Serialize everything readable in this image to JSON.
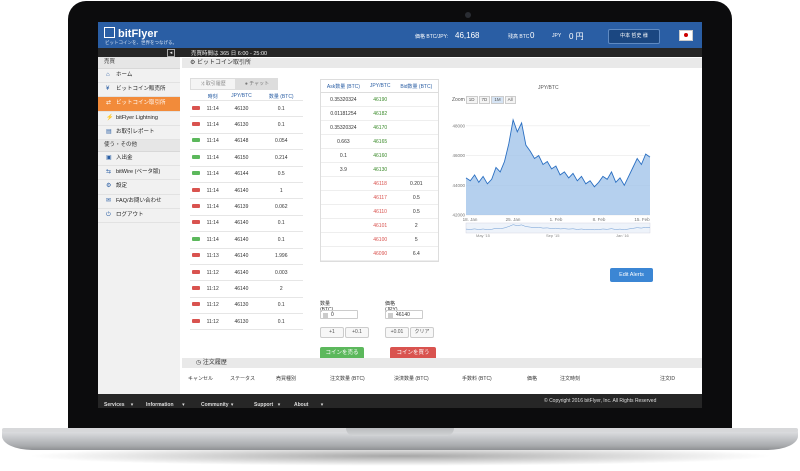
{
  "header": {
    "brand": "bitFlyer",
    "tagline": "ビットコインを、世界をつなげる。",
    "price_label": "価格 BTC/JPY:",
    "price_value": "46,168",
    "balance_btc_label": "残高 BTC",
    "balance_btc_value": "0",
    "balance_jpy_label": "JPY",
    "balance_jpy_value": "0 円",
    "user_button": "中本 哲史 様",
    "flag": "japan-flag-icon"
  },
  "timebar": {
    "hours": "売買時間は 365 日 6:00 - 25:00"
  },
  "sidebar": {
    "section1": "売買",
    "items": [
      {
        "label": "ホーム",
        "icon": "home-icon"
      },
      {
        "label": "ビットコイン販売所",
        "icon": "yen-icon"
      },
      {
        "label": "ビットコイン取引所",
        "icon": "exchange-icon"
      },
      {
        "label": "bitFlyer Lightning",
        "icon": "lightning-icon"
      },
      {
        "label": "お取引レポート",
        "icon": "report-icon"
      }
    ],
    "section2": "使う・その他",
    "items2": [
      {
        "label": "入出金",
        "icon": "wallet-icon"
      },
      {
        "label": "bitWire (ベータ版)",
        "icon": "bitwire-icon"
      },
      {
        "label": "設定",
        "icon": "gear-icon"
      },
      {
        "label": "FAQ/お問い合わせ",
        "icon": "faq-icon"
      },
      {
        "label": "ログアウト",
        "icon": "logout-icon"
      }
    ]
  },
  "page": {
    "title": "ビットコイン取引所"
  },
  "tabs": {
    "history": "取引履歴",
    "chat": "チャット"
  },
  "trades": {
    "headers": [
      "時刻",
      "JPY/BTC",
      "数量 (BTC)"
    ],
    "rows": [
      {
        "side": "sell",
        "time": "11:14",
        "price": "46130",
        "qty": "0.1"
      },
      {
        "side": "sell",
        "time": "11:14",
        "price": "46130",
        "qty": "0.1"
      },
      {
        "side": "buy",
        "time": "11:14",
        "price": "46148",
        "qty": "0.054"
      },
      {
        "side": "buy",
        "time": "11:14",
        "price": "46150",
        "qty": "0.214"
      },
      {
        "side": "buy",
        "time": "11:14",
        "price": "46144",
        "qty": "0.5"
      },
      {
        "side": "sell",
        "time": "11:14",
        "price": "46140",
        "qty": "1"
      },
      {
        "side": "sell",
        "time": "11:14",
        "price": "46139",
        "qty": "0.062"
      },
      {
        "side": "sell",
        "time": "11:14",
        "price": "46140",
        "qty": "0.1"
      },
      {
        "side": "buy",
        "time": "11:14",
        "price": "46140",
        "qty": "0.1"
      },
      {
        "side": "sell",
        "time": "11:13",
        "price": "46140",
        "qty": "1.996"
      },
      {
        "side": "sell",
        "time": "11:12",
        "price": "46140",
        "qty": "0.003"
      },
      {
        "side": "sell",
        "time": "11:12",
        "price": "46140",
        "qty": "2"
      },
      {
        "side": "sell",
        "time": "11:12",
        "price": "46130",
        "qty": "0.1"
      },
      {
        "side": "sell",
        "time": "11:12",
        "price": "46130",
        "qty": "0.1"
      }
    ]
  },
  "orderbook": {
    "headers": [
      "Ask数量 (BTC)",
      "JPY/BTC",
      "Bid数量 (BTC)"
    ],
    "asks": [
      {
        "qty": "0.35320324",
        "price": "46190"
      },
      {
        "qty": "0.01181254",
        "price": "46182"
      },
      {
        "qty": "0.35320324",
        "price": "46170"
      },
      {
        "qty": "0.663",
        "price": "46165"
      },
      {
        "qty": "0.1",
        "price": "46160"
      },
      {
        "qty": "3.9",
        "price": "46130"
      }
    ],
    "bids": [
      {
        "price": "46118",
        "qty": "0.201"
      },
      {
        "price": "46117",
        "qty": "0.5"
      },
      {
        "price": "46110",
        "qty": "0.5"
      },
      {
        "price": "46101",
        "qty": "2"
      },
      {
        "price": "46100",
        "qty": "5"
      },
      {
        "price": "46090",
        "qty": "6.4"
      }
    ]
  },
  "order_form": {
    "qty_label": "数量 (BTC)",
    "qty_value": "0",
    "price_label": "価格 (JPY)",
    "price_value": "46140",
    "steps": [
      "+1",
      "+0.1",
      "+0.01",
      "クリア"
    ],
    "sell_button": "コインを売る",
    "buy_button": "コインを買う"
  },
  "chart_panel": {
    "title": "JPY/BTC",
    "zoom_label": "Zoom",
    "zoom_options": [
      "1D",
      "7D",
      "1M",
      "All"
    ],
    "zoom_selected": "1M",
    "alerts_button": "Edit Alerts"
  },
  "chart_data": {
    "type": "area",
    "title": "JPY/BTC",
    "x_ticks": [
      "18. Jan",
      "25. Jan",
      "1. Feb",
      "8. Feb",
      "15. Feb"
    ],
    "y_ticks": [
      "48000",
      "46000",
      "44000",
      "42000"
    ],
    "ylim": [
      42000,
      49000
    ],
    "nav_labels": [
      "May '15",
      "Sep '15",
      "Jan '16"
    ],
    "y_values": [
      44500,
      44300,
      44700,
      44200,
      44600,
      44100,
      44400,
      45200,
      44900,
      45600,
      46800,
      48400,
      47600,
      48200,
      46700,
      46300,
      45800,
      46000,
      45400,
      45600,
      45100,
      45300,
      44700,
      44900,
      44500,
      44800,
      44300,
      44600,
      44100,
      44300,
      43900,
      44200,
      44600,
      44400,
      44900,
      44200,
      44500,
      44000,
      44600,
      45200,
      45800,
      45400,
      46100,
      45900
    ]
  },
  "order_history": {
    "title": "注文履歴",
    "columns": [
      "キャンセル",
      "ステータス",
      "売買種別",
      "注文数量 (BTC)",
      "決済数量 (BTC)",
      "手数料 (BTC)",
      "価格",
      "注文時刻",
      "注文ID"
    ]
  },
  "footer": {
    "links": [
      "Services",
      "Information",
      "Community",
      "Support",
      "About Us"
    ],
    "copyright": "© Copyright 2016 bitFlyer, Inc. All Rights Reserved"
  }
}
